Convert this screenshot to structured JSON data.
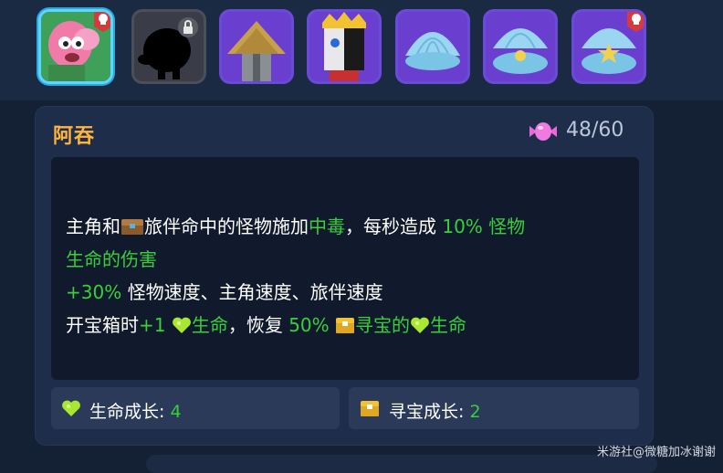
{
  "roster": {
    "items": [
      {
        "id": "slot-1",
        "state": "selected",
        "art": "pink-worm-icon",
        "badge": true
      },
      {
        "id": "slot-2",
        "state": "locked",
        "art": "silhouette-icon",
        "badge": false
      },
      {
        "id": "slot-3",
        "state": "normal",
        "art": "straw-hat-icon",
        "badge": false
      },
      {
        "id": "slot-4",
        "state": "normal",
        "art": "crowned-face-icon",
        "badge": false
      },
      {
        "id": "slot-5",
        "state": "normal",
        "art": "shell-icon",
        "badge": false
      },
      {
        "id": "slot-6",
        "state": "normal",
        "art": "shell-open-icon",
        "badge": false
      },
      {
        "id": "slot-7",
        "state": "normal",
        "art": "shell-star-icon",
        "badge": true
      }
    ]
  },
  "card": {
    "name": "阿吞",
    "count": "48/60",
    "description": {
      "line1_a": "主角和",
      "line1_b": "旅伴命中的怪物施加",
      "line1_c": "中毒",
      "line1_d": "，每秒造成 ",
      "line1_e": "10% 怪物",
      "line2": "生命的伤害",
      "line3_a": "+30%",
      "line3_b": " 怪物速度、主角速度、旅伴速度",
      "line4_a": "开宝箱时",
      "line4_b": "+1 ",
      "line4_c": "生命",
      "line4_d": "，恢复 ",
      "line4_e": "50% ",
      "line4_f": "寻宝的",
      "line4_g": "生命"
    },
    "stats": [
      {
        "label": "生命成长: ",
        "value": "4",
        "icon": "heart-icon"
      },
      {
        "label": "寻宝成长: ",
        "value": "2",
        "icon": "chest-icon"
      }
    ]
  },
  "watermark": "米游社@微糖加冰谢谢",
  "colors": {
    "accent_green": "#36d03a",
    "name_orange": "#ffb43a",
    "selected_border": "#5cd6ff",
    "slot_purple": "#6a3fd0"
  }
}
